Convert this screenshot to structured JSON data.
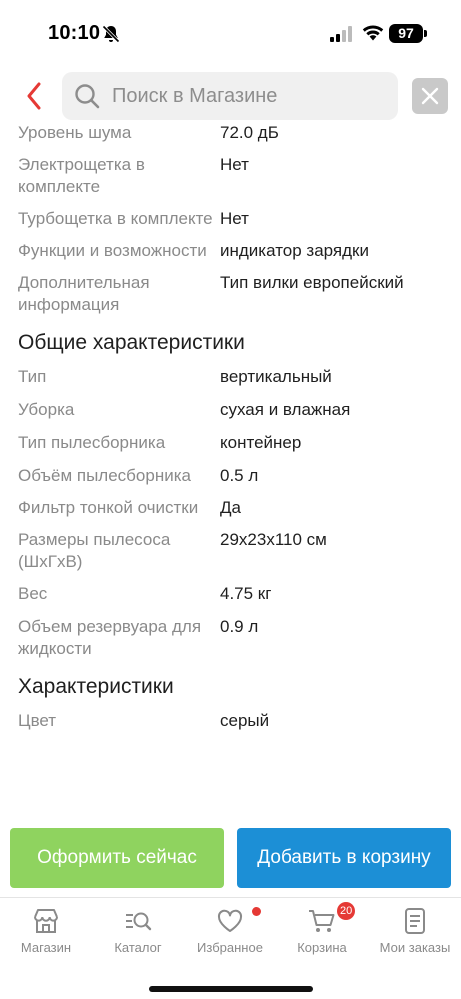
{
  "status_bar": {
    "time": "10:10",
    "battery": "97"
  },
  "header": {
    "search_placeholder": "Поиск в Магазине"
  },
  "specs_top": [
    {
      "label": "Уровень шума",
      "value": "72.0 дБ"
    },
    {
      "label": "Электрощетка в комплекте",
      "value": "Нет"
    },
    {
      "label": "Турбощетка в комплекте",
      "value": "Нет"
    },
    {
      "label": "Функции и возможности",
      "value": "индикатор зарядки"
    },
    {
      "label": "Дополнительная информация",
      "value": "Тип вилки европейский"
    }
  ],
  "section_general": {
    "title": "Общие характеристики"
  },
  "specs_general": [
    {
      "label": "Тип",
      "value": "вертикальный"
    },
    {
      "label": "Уборка",
      "value": "сухая и влажная"
    },
    {
      "label": "Тип пылесборника",
      "value": "контейнер"
    },
    {
      "label": "Объём пылесборника",
      "value": "0.5 л"
    },
    {
      "label": "Фильтр тонкой очистки",
      "value": "Да"
    },
    {
      "label": "Размеры пылесоса (ШхГхВ)",
      "value": "29x23x110 см"
    },
    {
      "label": "Вес",
      "value": "4.75 кг"
    },
    {
      "label": "Объем резервуара для жидкости",
      "value": "0.9 л"
    }
  ],
  "section_chars": {
    "title": "Характеристики"
  },
  "specs_chars": [
    {
      "label": "Цвет",
      "value": "серый"
    }
  ],
  "actions": {
    "checkout": "Оформить сейчас",
    "add_to_cart": "Добавить в корзину"
  },
  "tabbar": {
    "shop": "Магазин",
    "catalog": "Каталог",
    "favorites": "Избранное",
    "cart": "Корзина",
    "cart_count": "20",
    "orders": "Мои заказы"
  },
  "colors": {
    "accent_green": "#8fd35f",
    "accent_blue": "#1c8fd6",
    "badge_red": "#e53935",
    "back_red": "#e53935"
  }
}
